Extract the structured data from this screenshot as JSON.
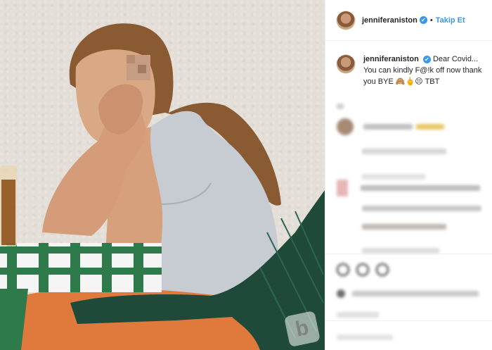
{
  "header": {
    "username": "jenniferaniston",
    "verified_mark": "✔",
    "separator": "•",
    "follow_label": "Takip Et"
  },
  "caption": {
    "username": "jenniferaniston",
    "text": "Dear Covid... You can kindly F@!k off now thank you BYE 🙈🖕😣 TBT"
  },
  "watermark": {
    "letter": "b"
  },
  "icons": [
    "avatar",
    "verified-icon",
    "heart-icon",
    "comment-icon",
    "share-icon"
  ],
  "colors": {
    "accent": "#3897f0",
    "text": "#262626",
    "border": "#efefef"
  }
}
